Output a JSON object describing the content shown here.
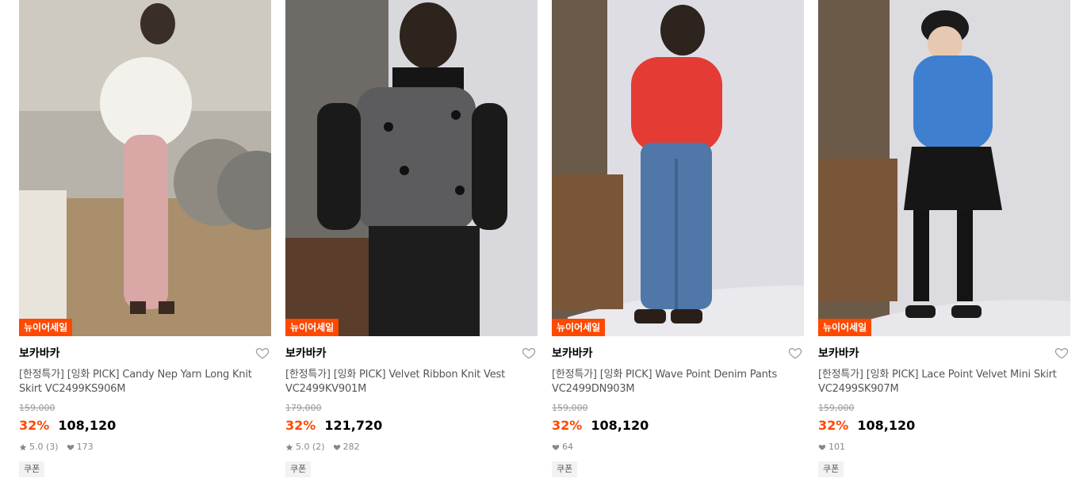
{
  "products": [
    {
      "badge": "뉴이어세일",
      "brand": "보카바카",
      "name": "[한정특가] [잉화 PICK] Candy Nep Yarn Long Knit Skirt VC2499KS906M",
      "original_price": "159,000",
      "discount": "32%",
      "price": "108,120",
      "rating": "5.0 (3)",
      "likes": "173",
      "coupon": "쿠폰"
    },
    {
      "badge": "뉴이어세일",
      "brand": "보카바카",
      "name": "[한정특가] [잉화 PICK] Velvet Ribbon Knit Vest VC2499KV901M",
      "original_price": "179,000",
      "discount": "32%",
      "price": "121,720",
      "rating": "5.0 (2)",
      "likes": "282",
      "coupon": "쿠폰"
    },
    {
      "badge": "뉴이어세일",
      "brand": "보카바카",
      "name": "[한정특가] [잉화 PICK] Wave Point Denim Pants VC2499DN903M",
      "original_price": "159,000",
      "discount": "32%",
      "price": "108,120",
      "rating": "",
      "likes": "64",
      "coupon": "쿠폰"
    },
    {
      "badge": "뉴이어세일",
      "brand": "보카바카",
      "name": "[한정특가] [잉화 PICK] Lace Point Velvet Mini Skirt VC2499SK907M",
      "original_price": "159,000",
      "discount": "32%",
      "price": "108,120",
      "rating": "",
      "likes": "101",
      "coupon": "쿠폰"
    }
  ],
  "colors": {
    "accent": "#ff4800",
    "text_muted": "#555555",
    "text_light": "#999999"
  },
  "icons": {
    "wishlist": "heart-outline-icon",
    "rating": "star-icon",
    "likes": "heart-filled-icon"
  }
}
